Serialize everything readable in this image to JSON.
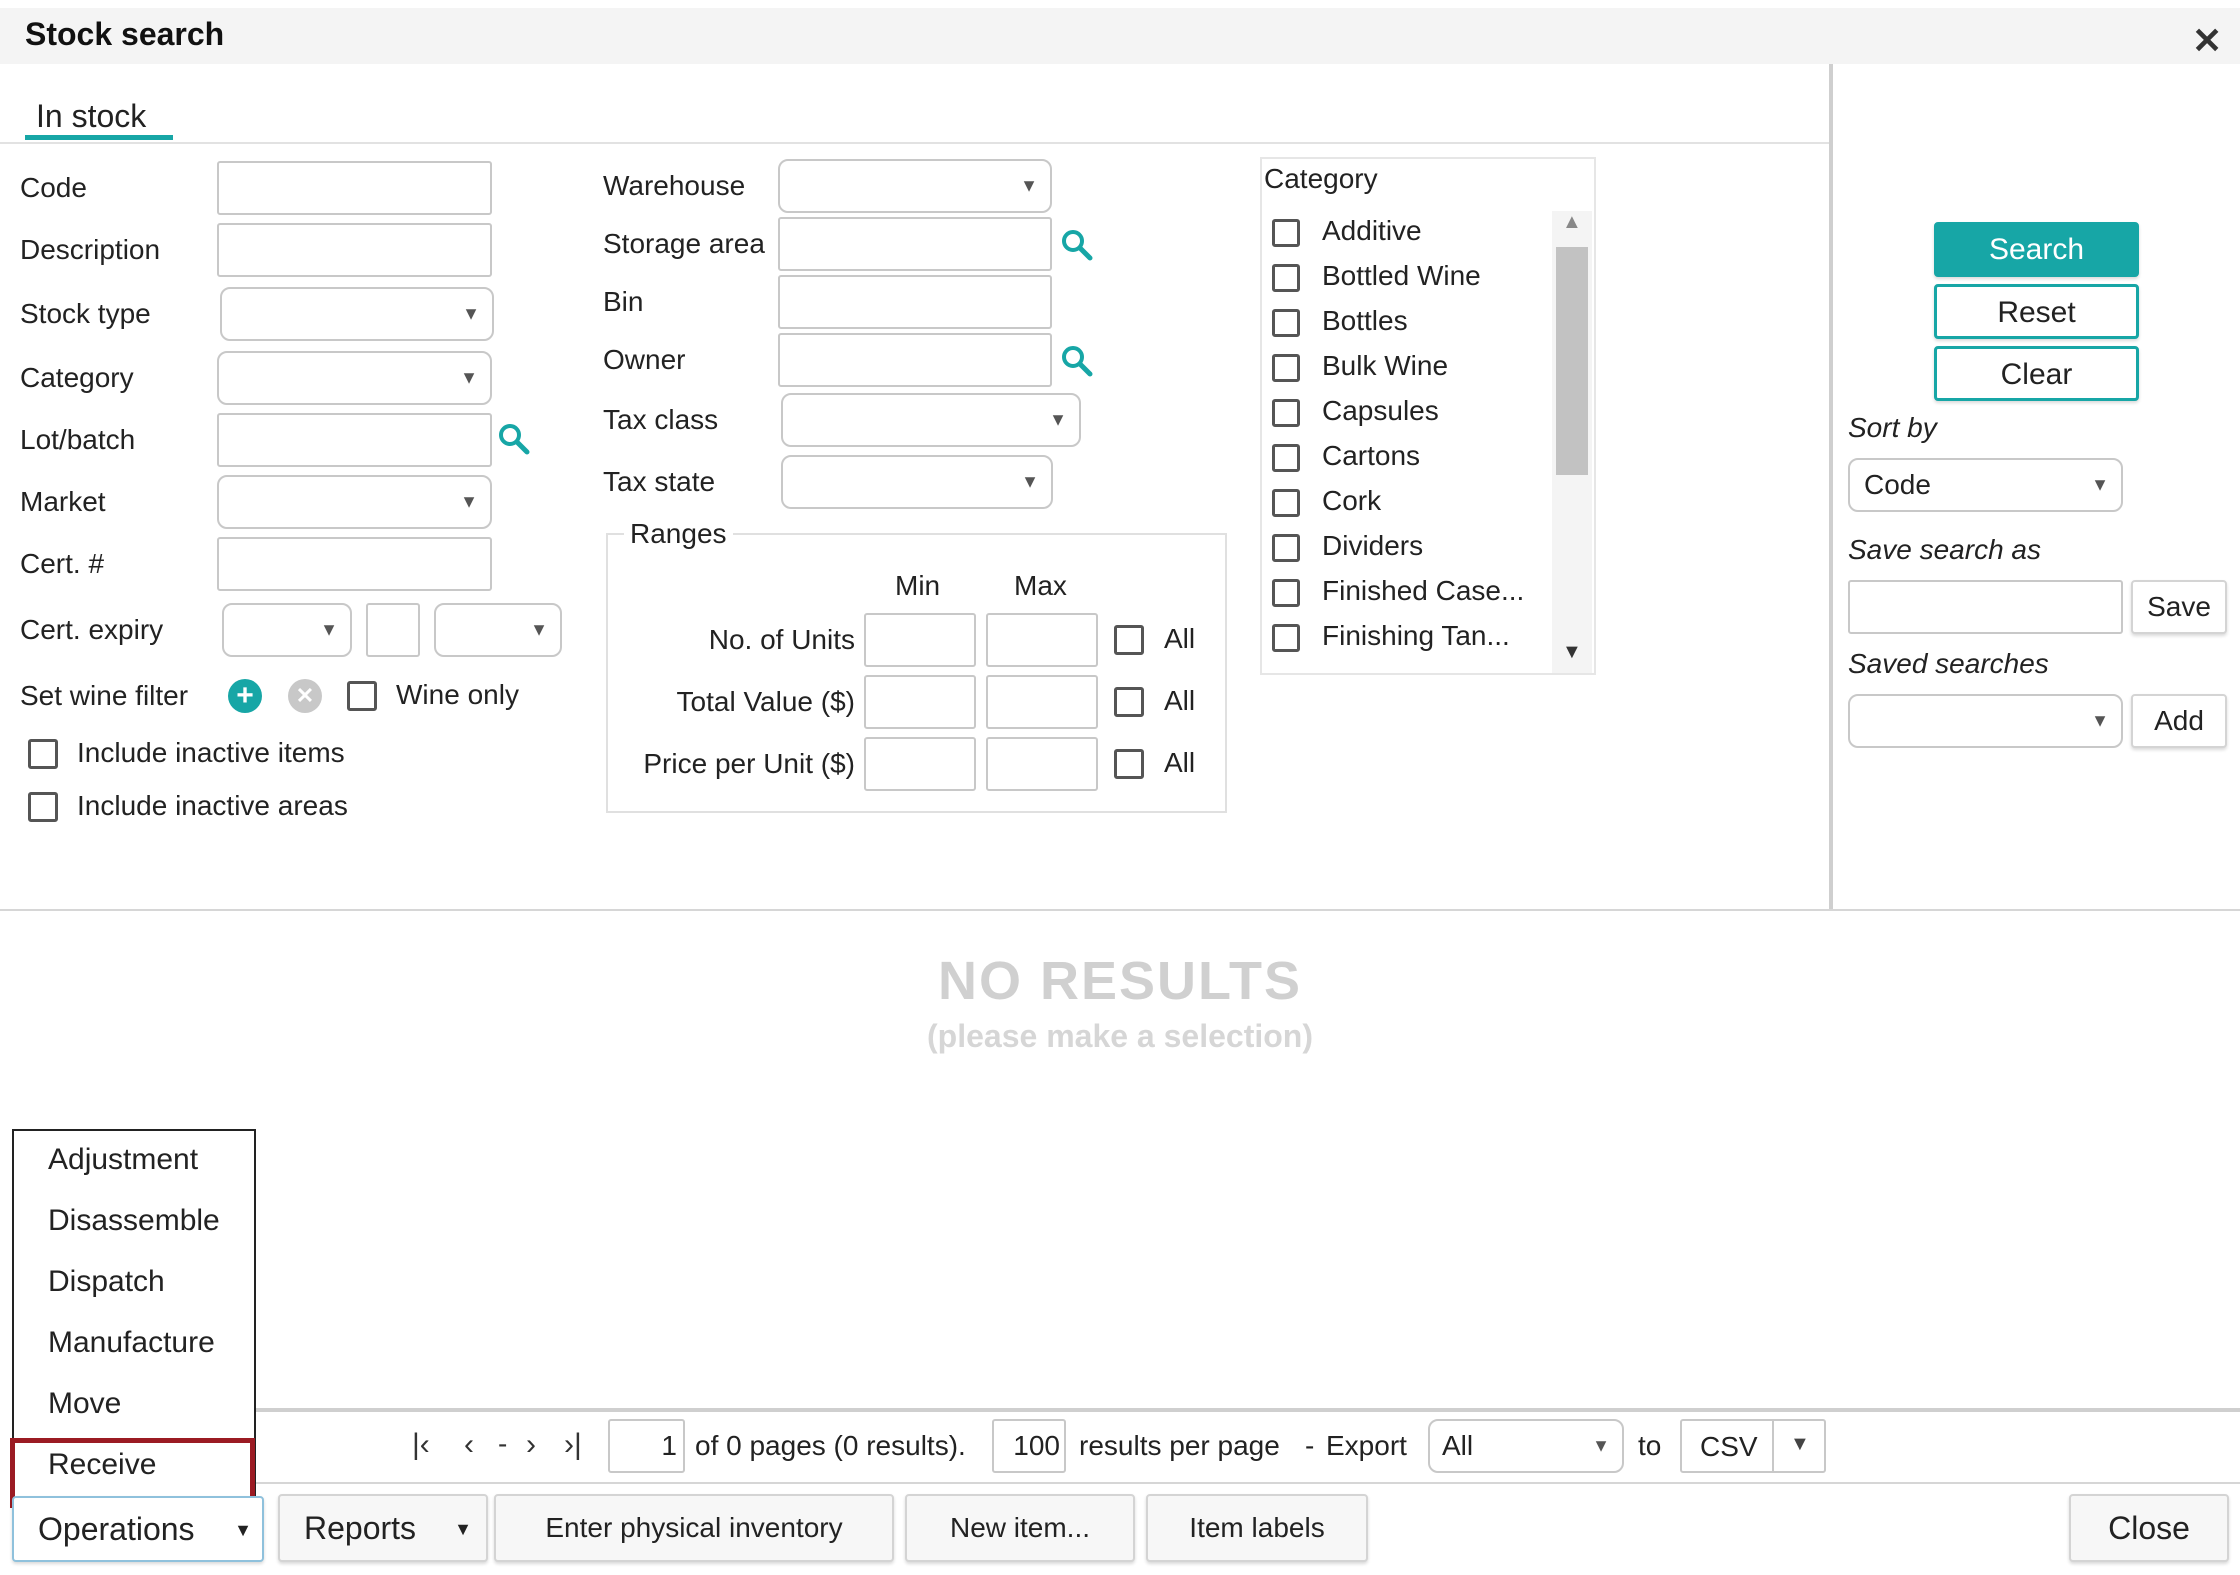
{
  "window": {
    "title": "Stock search"
  },
  "tabs": [
    {
      "label": "In stock"
    }
  ],
  "form": {
    "code_label": "Code",
    "description_label": "Description",
    "stock_type_label": "Stock type",
    "category_label": "Category",
    "lot_batch_label": "Lot/batch",
    "market_label": "Market",
    "cert_no_label": "Cert. #",
    "cert_expiry_label": "Cert. expiry",
    "set_wine_filter_label": "Set wine filter",
    "wine_only_label": "Wine only",
    "include_inactive_items_label": "Include inactive items",
    "include_inactive_areas_label": "Include inactive areas",
    "warehouse_label": "Warehouse",
    "storage_area_label": "Storage area",
    "bin_label": "Bin",
    "owner_label": "Owner",
    "tax_class_label": "Tax class",
    "tax_state_label": "Tax state"
  },
  "ranges": {
    "title": "Ranges",
    "min_label": "Min",
    "max_label": "Max",
    "all_label": "All",
    "rows": [
      {
        "label": "No. of Units"
      },
      {
        "label": "Total Value ($)"
      },
      {
        "label": "Price per Unit ($)"
      }
    ]
  },
  "category_list": {
    "title": "Category",
    "items": [
      "Additive",
      "Bottled Wine",
      "Bottles",
      "Bulk Wine",
      "Capsules",
      "Cartons",
      "Cork",
      "Dividers",
      "Finished Case...",
      "Finishing Tan..."
    ]
  },
  "side": {
    "search_label": "Search",
    "reset_label": "Reset",
    "clear_label": "Clear",
    "sort_by_label": "Sort by",
    "sort_by_value": "Code",
    "save_search_as_label": "Save search as",
    "save_label": "Save",
    "saved_searches_label": "Saved searches",
    "add_label": "Add"
  },
  "results": {
    "empty_title": "NO RESULTS",
    "empty_hint": "(please make a selection)"
  },
  "pager": {
    "first_icon": "first-page-icon",
    "prev_icon": "prev-page-icon",
    "separator": "-",
    "page_value": "1",
    "of_pages_text": "of 0 pages (0 results).",
    "per_page_value": "100",
    "per_page_text": "results per page",
    "dash": "-",
    "export_label": "Export",
    "export_scope_value": "All",
    "to_label": "to",
    "format_value": "CSV"
  },
  "operations_menu": {
    "items": [
      "Adjustment",
      "Disassemble",
      "Dispatch",
      "Manufacture",
      "Move",
      "Receive"
    ],
    "highlighted": "Receive"
  },
  "footer": {
    "operations_label": "Operations",
    "reports_label": "Reports",
    "enter_inventory_label": "Enter physical inventory",
    "new_item_label": "New item...",
    "item_labels_label": "Item labels",
    "close_label": "Close"
  },
  "colors": {
    "accent": "#17a6a6",
    "highlight_border": "#9b1b23",
    "muted_text": "#d0d0d0"
  }
}
